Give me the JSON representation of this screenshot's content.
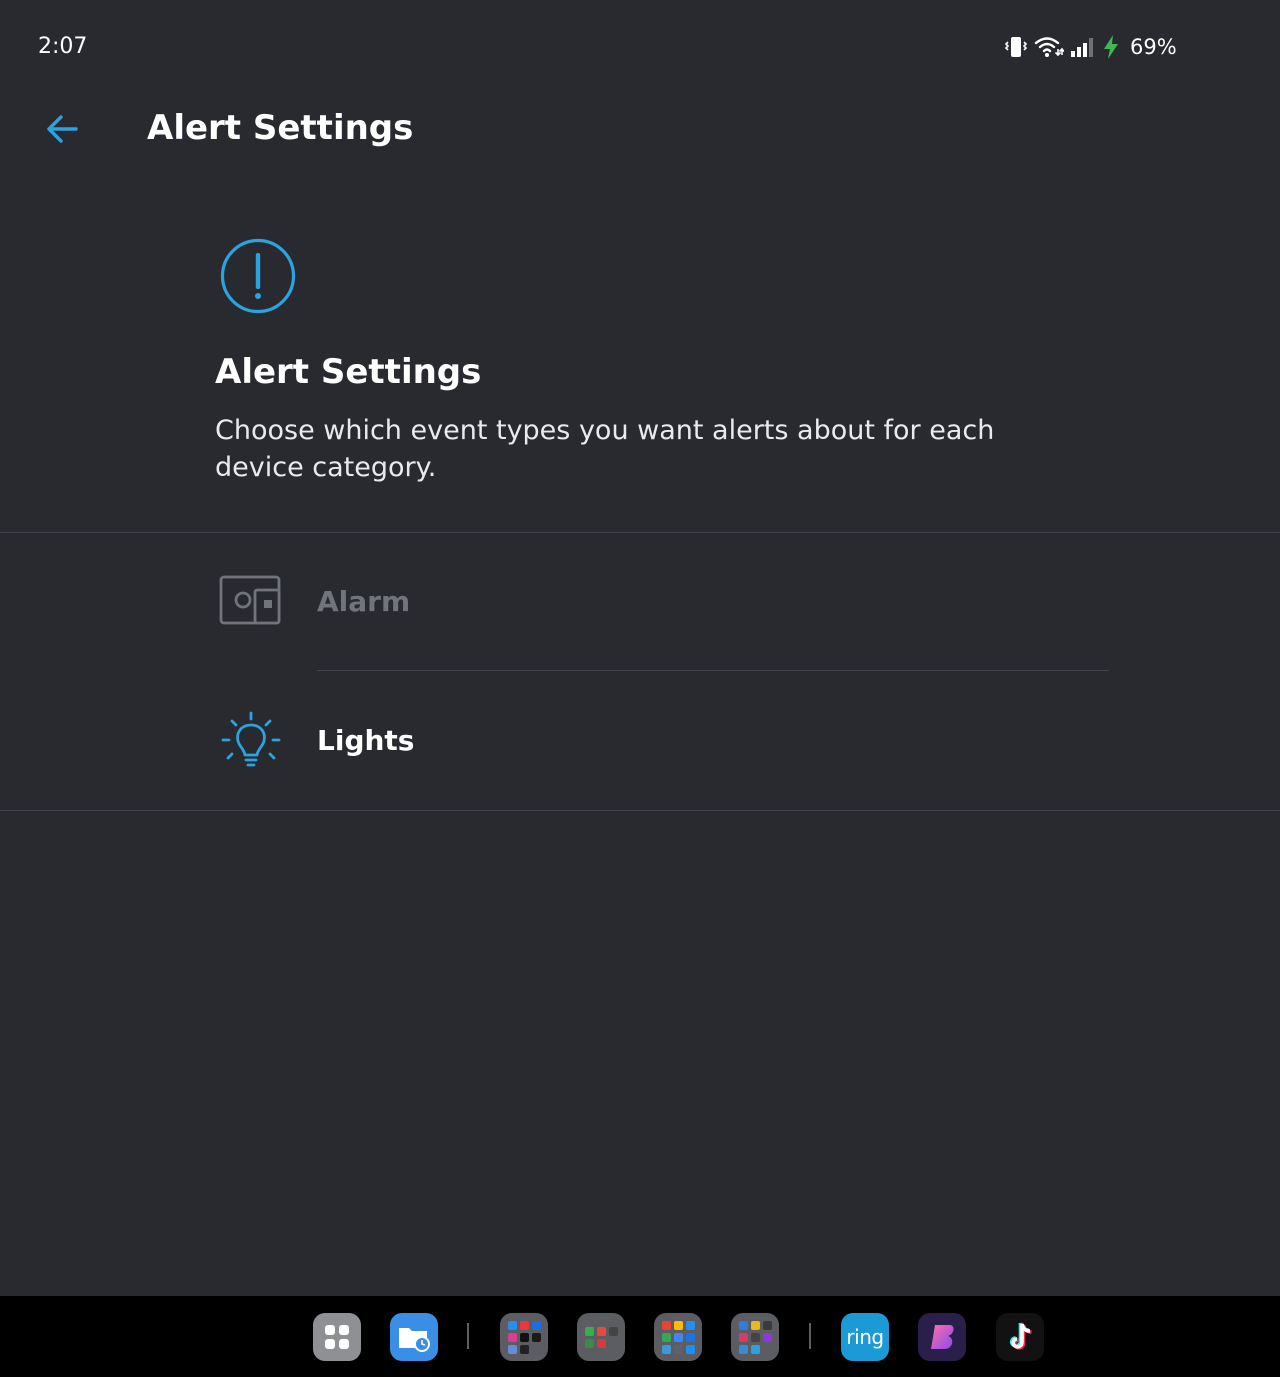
{
  "status_bar": {
    "time": "2:07",
    "battery_percent": "69%",
    "icons": [
      "vibrate-icon",
      "wifi-icon",
      "signal-icon",
      "charging-icon"
    ]
  },
  "app_bar": {
    "title": "Alert Settings",
    "back_icon": "arrow-left-icon"
  },
  "header": {
    "icon": "alert-circle-icon",
    "title": "Alert Settings",
    "description": "Choose which event types you want alerts about for each device category."
  },
  "categories": [
    {
      "label": "Alarm",
      "icon": "alarm-base-icon",
      "enabled": false
    },
    {
      "label": "Lights",
      "icon": "lightbulb-icon",
      "enabled": true
    }
  ],
  "taskbar": {
    "apps": [
      "apps-grid",
      "my-files",
      "folder-social",
      "folder-media",
      "folder-google",
      "folder-tools",
      "ring",
      "pen-app",
      "tiktok"
    ],
    "ring_label": "ring"
  },
  "colors": {
    "background": "#282a30",
    "accent": "#2aa3e0",
    "disabled_text": "#71747b",
    "divider": "#41444b",
    "taskbar": "#000000"
  }
}
